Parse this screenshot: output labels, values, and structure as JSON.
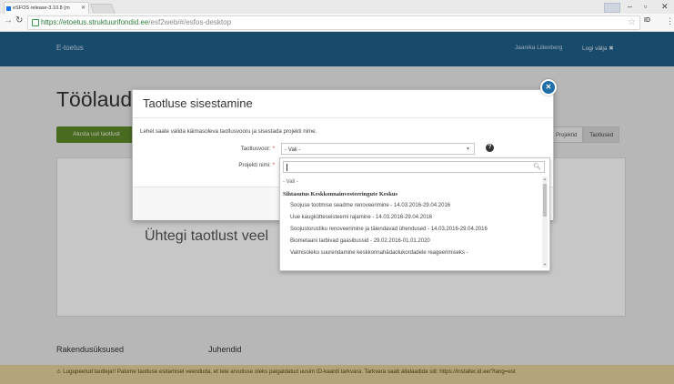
{
  "browser": {
    "tab_title": "eSFOS release-3.10.8 (m",
    "url_host": "https://etoetus.struktuurifondid.ee",
    "url_path": "/esf2web/#/esfos-desktop",
    "ext_label": "ID"
  },
  "app": {
    "brand": "E-toetus",
    "user_name": "Jaanika Lilienberg",
    "logout_label": "Logi välja ✖",
    "page_title": "Töölaud",
    "start_button": "Alusta uut taotlust",
    "tabs": [
      "Projektid",
      "Taotlused"
    ],
    "empty_message": "Ühtegi taotlust veel",
    "footer_links": [
      "Rakendusüksused",
      "Juhendid"
    ],
    "notice": "⚠ Lugupeetud taotleja!! Palume taotluse esitamisel veenduda, et teie arvutisse oleks paigaldatud uusim ID-kaardi tarkvara. Tarkvara saab allalaadida siit: https://installer.id.ee/?lang=est"
  },
  "modal": {
    "title": "Taotluse sisestamine",
    "description": "Lehel saate valida käimasoleva taotlusvooru ja sisestada projekti nime.",
    "round_label": "Taotlusvoor:",
    "name_label": "Projekti nimi:",
    "required_mark": "*",
    "selected_value": "- Vali -"
  },
  "dropdown": {
    "first_option": "- Vali -",
    "group_label": "Sihtasutus Keskkonnainvesteeringute Keskus",
    "options": [
      "Soojuse tootmise seadme renoveerimine - 14.03.2016-29.04.2016",
      "Uue kaugkütteseisteemi rajamine - 14.03.2016-29.04.2016",
      "Soojustorustiku renoveerimine ja täiendavad ühendused - 14.03.2016-29.04.2016",
      "Biometaani tarbivad gaasibussid - 29.02.2016-01.01.2020",
      "Valmisoleku suurendamine keskkonnahädaolukordadele reageerimiseks -"
    ]
  }
}
